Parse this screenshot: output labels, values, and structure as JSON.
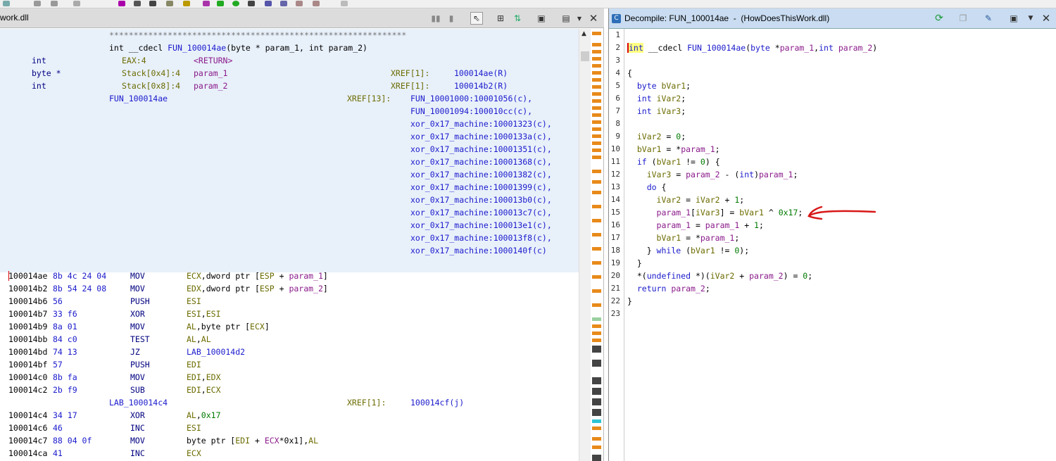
{
  "listing": {
    "title": "work.dll",
    "separator": "*************************************************************",
    "signature": {
      "prefix": "int __cdecl ",
      "name": "FUN_100014ae",
      "args": "(byte * param_1, int param_2)"
    },
    "params": [
      {
        "type": "int",
        "loc": "EAX:4",
        "name": "<RETURN>",
        "xref": "",
        "xaddr": ""
      },
      {
        "type": "byte *",
        "loc": "Stack[0x4]:4",
        "name": "param_1",
        "xref": "XREF[1]:",
        "xaddr": "100014ae(R)"
      },
      {
        "type": "int",
        "loc": "Stack[0x8]:4",
        "name": "param_2",
        "xref": "XREF[1]:",
        "xaddr": "100014b2(R)"
      }
    ],
    "label": "FUN_100014ae",
    "label_xref": "XREF[13]:",
    "xrefs": [
      "FUN_10001000:10001056(c),",
      "FUN_10001094:100010cc(c),",
      "xor_0x17_machine:10001323(c),",
      "xor_0x17_machine:1000133a(c),",
      "xor_0x17_machine:10001351(c),",
      "xor_0x17_machine:10001368(c),",
      "xor_0x17_machine:10001382(c),",
      "xor_0x17_machine:10001399(c),",
      "xor_0x17_machine:100013b0(c),",
      "xor_0x17_machine:100013c7(c),",
      "xor_0x17_machine:100013e1(c),",
      "xor_0x17_machine:100013f8(c),",
      "xor_0x17_machine:1000140f(c)"
    ],
    "instructions1": [
      {
        "addr": "100014ae",
        "bytes": "8b 4c 24 04",
        "mn": "MOV",
        "a": "ECX",
        "b": ",dword ptr [",
        "c": "ESP",
        "d": " + ",
        "e": "param_1",
        "f": "]"
      },
      {
        "addr": "100014b2",
        "bytes": "8b 54 24 08",
        "mn": "MOV",
        "a": "EDX",
        "b": ",dword ptr [",
        "c": "ESP",
        "d": " + ",
        "e": "param_2",
        "f": "]"
      },
      {
        "addr": "100014b6",
        "bytes": "56",
        "mn": "PUSH",
        "a": "ESI",
        "b": "",
        "c": "",
        "d": "",
        "e": "",
        "f": ""
      },
      {
        "addr": "100014b7",
        "bytes": "33 f6",
        "mn": "XOR",
        "a": "ESI",
        "b": ",",
        "c": "ESI",
        "d": "",
        "e": "",
        "f": ""
      },
      {
        "addr": "100014b9",
        "bytes": "8a 01",
        "mn": "MOV",
        "a": "AL",
        "b": ",byte ptr [",
        "c": "ECX",
        "d": "",
        "e": "",
        "f": "]"
      },
      {
        "addr": "100014bb",
        "bytes": "84 c0",
        "mn": "TEST",
        "a": "AL",
        "b": ",",
        "c": "AL",
        "d": "",
        "e": "",
        "f": ""
      },
      {
        "addr": "100014bd",
        "bytes": "74 13",
        "mn": "JZ",
        "a": "",
        "b": "",
        "c": "",
        "d": "",
        "e": "",
        "f": "",
        "lab": "LAB_100014d2"
      },
      {
        "addr": "100014bf",
        "bytes": "57",
        "mn": "PUSH",
        "a": "EDI",
        "b": "",
        "c": "",
        "d": "",
        "e": "",
        "f": ""
      },
      {
        "addr": "100014c0",
        "bytes": "8b fa",
        "mn": "MOV",
        "a": "EDI",
        "b": ",",
        "c": "EDX",
        "d": "",
        "e": "",
        "f": ""
      },
      {
        "addr": "100014c2",
        "bytes": "2b f9",
        "mn": "SUB",
        "a": "EDI",
        "b": ",",
        "c": "ECX",
        "d": "",
        "e": "",
        "f": ""
      }
    ],
    "label2": "LAB_100014c4",
    "label2_xref": "XREF[1]:",
    "label2_xaddr": "100014cf(j)",
    "instructions2": [
      {
        "addr": "100014c4",
        "bytes": "34 17",
        "mn": "XOR",
        "a": "AL",
        "b": ",",
        "c": "",
        "d": "",
        "e": "",
        "f": "",
        "num": "0x17"
      },
      {
        "addr": "100014c6",
        "bytes": "46",
        "mn": "INC",
        "a": "ESI",
        "b": "",
        "c": "",
        "d": "",
        "e": "",
        "f": ""
      },
      {
        "addr": "100014c7",
        "bytes": "88 04 0f",
        "mn": "MOV",
        "a": "",
        "b": "byte ptr [",
        "c": "EDI",
        "d": " + ",
        "e": "ECX",
        "f": "*0x1],",
        "g": "AL"
      },
      {
        "addr": "100014ca",
        "bytes": "41",
        "mn": "INC",
        "a": "ECX",
        "b": "",
        "c": "",
        "d": "",
        "e": "",
        "f": ""
      }
    ]
  },
  "decompile": {
    "title": "Decompile: FUN_100014ae  -  (HowDoesThisWork.dll)",
    "line_numbers": [
      "1",
      "2",
      "3",
      "4",
      "5",
      "6",
      "7",
      "8",
      "9",
      "10",
      "11",
      "12",
      "13",
      "14",
      "15",
      "16",
      "17",
      "18",
      "19",
      "20",
      "21",
      "22",
      "23"
    ]
  },
  "colors": {
    "annotation_arrow": "#d81818",
    "header_bg": "#e8f0fa",
    "decomp_header": "#c9dcf1"
  },
  "icons": [
    "refresh-icon",
    "copy-icon",
    "edit-icon",
    "snapshot-icon",
    "menu-dropdown-icon",
    "close-icon",
    "cursor-icon",
    "export-icon",
    "camera-icon"
  ]
}
